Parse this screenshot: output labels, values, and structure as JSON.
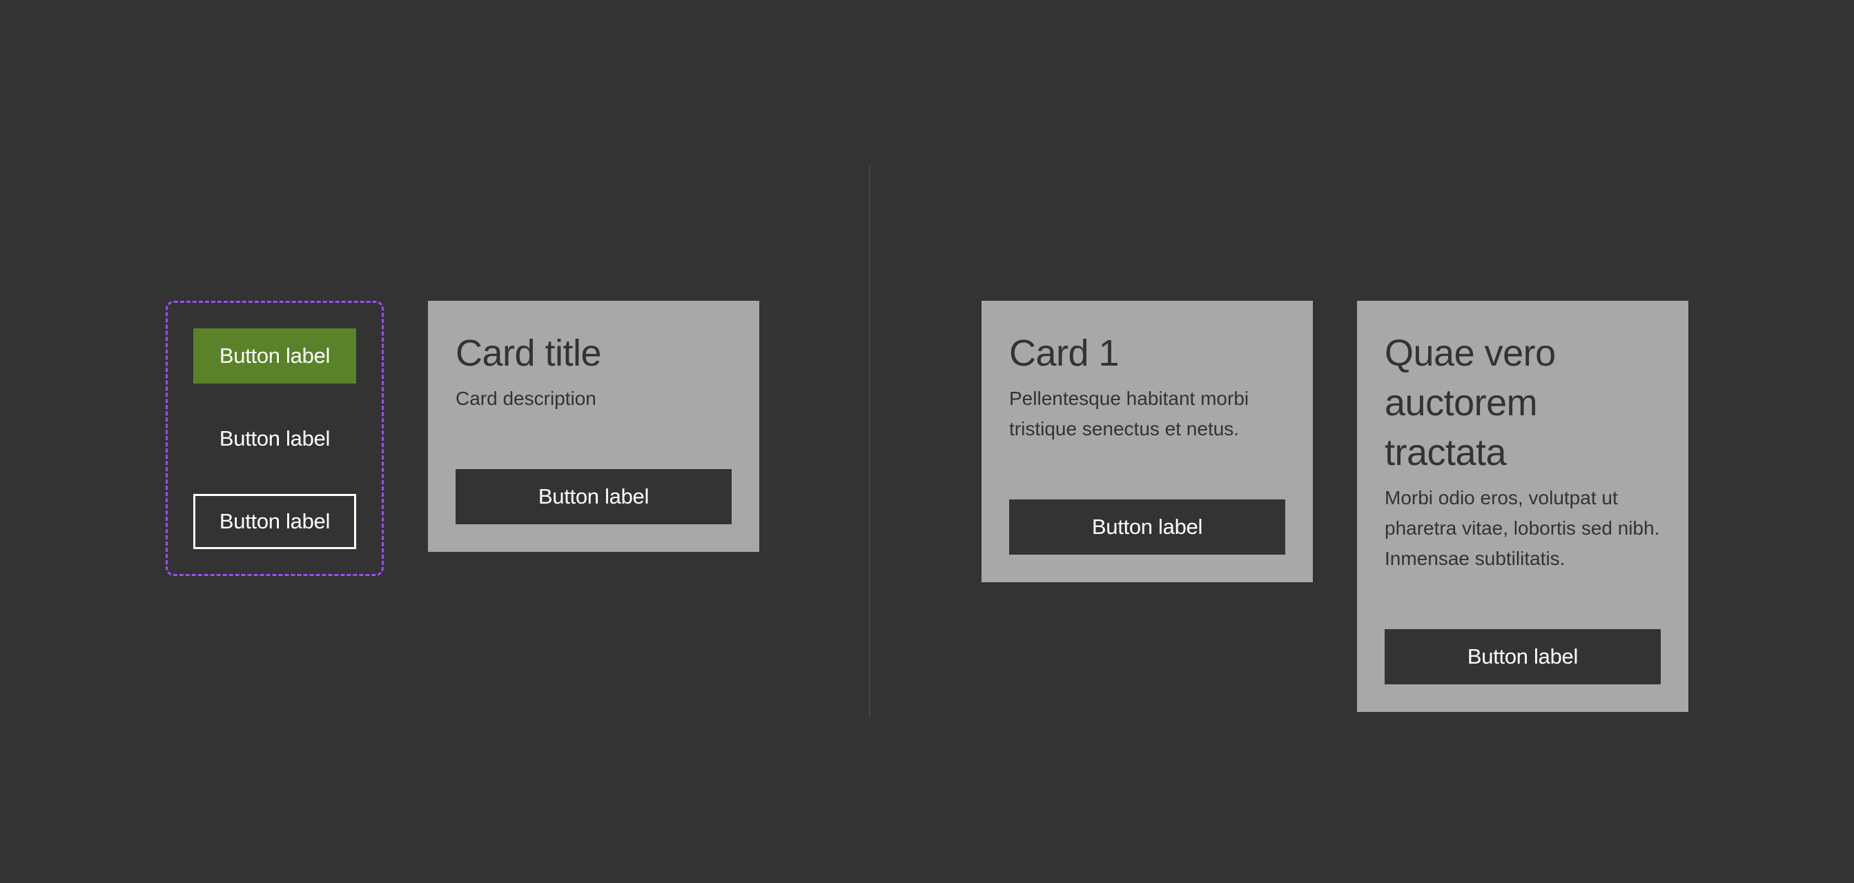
{
  "colors": {
    "background": "#333333",
    "card": "#a8a8a8",
    "primary_button": "#5a8228",
    "dashed_outline": "#9b4dff",
    "divider": "#444444"
  },
  "button_group": {
    "buttons": [
      {
        "variant": "primary",
        "label": "Button label"
      },
      {
        "variant": "ghost",
        "label": "Button label"
      },
      {
        "variant": "outline",
        "label": "Button label"
      }
    ]
  },
  "cards": [
    {
      "title": "Card title",
      "description": "Card description",
      "button_label": "Button label"
    },
    {
      "title": "Card 1",
      "description": "Pellentesque habitant morbi tristique senectus et netus.",
      "button_label": "Button label"
    },
    {
      "title": "Quae vero auctorem tractata",
      "description": "Morbi odio eros, volutpat ut pharetra vitae, lobortis sed nibh. Inmensae subtilitatis.",
      "button_label": "Button label"
    }
  ]
}
